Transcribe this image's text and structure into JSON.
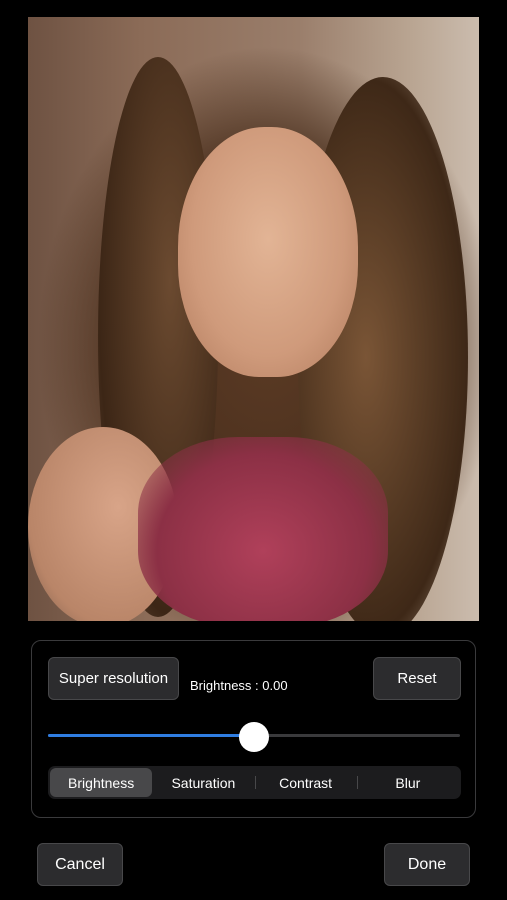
{
  "photo": {
    "description_icon": "portrait-photo"
  },
  "controls": {
    "super_resolution_label": "Super resolution",
    "brightness_readout": "Brightness : 0.00",
    "reset_label": "Reset",
    "slider": {
      "value_fraction": 0.5
    },
    "segments": [
      {
        "label": "Brightness",
        "selected": true
      },
      {
        "label": "Saturation",
        "selected": false
      },
      {
        "label": "Contrast",
        "selected": false
      },
      {
        "label": "Blur",
        "selected": false
      }
    ]
  },
  "footer": {
    "cancel_label": "Cancel",
    "done_label": "Done"
  },
  "colors": {
    "accent": "#2f7de1",
    "background": "#000000",
    "button": "#2c2c2e"
  }
}
